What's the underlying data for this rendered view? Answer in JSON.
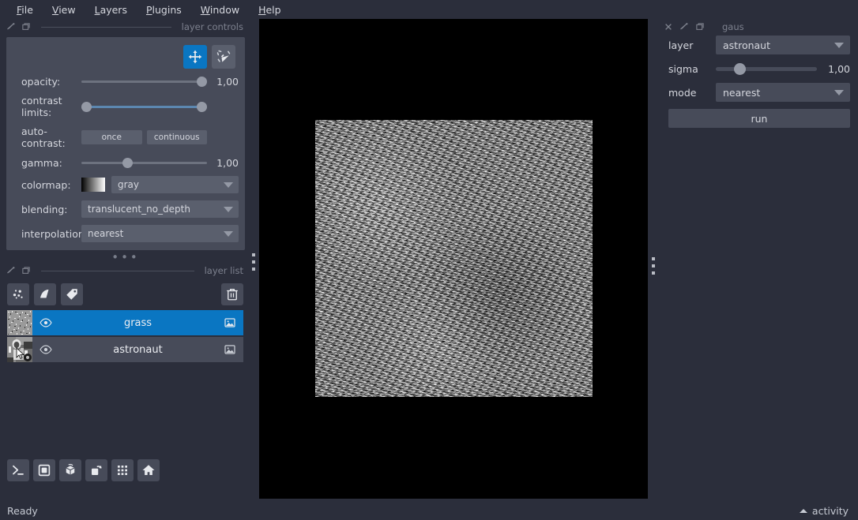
{
  "app": {
    "background": "#2b2e3b",
    "panel_background": "#474b59",
    "accent": "#0a76c2",
    "text": "#d4d6dd",
    "muted_text": "#7d818e"
  },
  "menubar": {
    "items": [
      {
        "label": "File",
        "mnemonic": "F"
      },
      {
        "label": "View",
        "mnemonic": "V"
      },
      {
        "label": "Layers",
        "mnemonic": "L"
      },
      {
        "label": "Plugins",
        "mnemonic": "P"
      },
      {
        "label": "Window",
        "mnemonic": "W"
      },
      {
        "label": "Help",
        "mnemonic": "H"
      }
    ]
  },
  "layer_controls": {
    "dock_title": "layer controls",
    "mode_buttons": [
      {
        "name": "pan-zoom",
        "icon": "move-icon",
        "active": true
      },
      {
        "name": "transform",
        "icon": "transform-icon",
        "active": false
      }
    ],
    "rows": {
      "opacity": {
        "label": "opacity:",
        "value": "1,00",
        "slider_pct": 100
      },
      "contrast_limits": {
        "label": "contrast limits:",
        "low_pct": 0,
        "high_pct": 100
      },
      "auto_contrast": {
        "label": "auto-contrast:",
        "once": "once",
        "continuous": "continuous"
      },
      "gamma": {
        "label": "gamma:",
        "value": "1,00",
        "slider_pct": 33
      },
      "colormap": {
        "label": "colormap:",
        "value": "gray"
      },
      "blending": {
        "label": "blending:",
        "value": "translucent_no_depth"
      },
      "interpolation": {
        "label": "interpolation:",
        "value": "nearest"
      }
    }
  },
  "layer_list": {
    "dock_title": "layer list",
    "toolbar": [
      {
        "name": "new-points-layer",
        "icon": "points-icon"
      },
      {
        "name": "new-shapes-layer",
        "icon": "shapes-icon"
      },
      {
        "name": "new-labels-layer",
        "icon": "labels-icon"
      }
    ],
    "delete_button": {
      "name": "delete-layer",
      "icon": "trash-icon"
    },
    "layers": [
      {
        "name": "grass",
        "selected": true,
        "visible": true,
        "type_icon": "image-icon",
        "thumbnail": "noise"
      },
      {
        "name": "astronaut",
        "selected": false,
        "visible": true,
        "type_icon": "image-icon",
        "thumbnail": "photo"
      }
    ]
  },
  "viewer_buttons": [
    {
      "name": "console-button",
      "icon": "terminal-icon"
    },
    {
      "name": "ndisplay-button",
      "icon": "square-icon"
    },
    {
      "name": "roll-dims-button",
      "icon": "cube-icon"
    },
    {
      "name": "transpose-dims-button",
      "icon": "transpose-icon"
    },
    {
      "name": "grid-view-button",
      "icon": "grid-icon"
    },
    {
      "name": "home-button",
      "icon": "home-icon"
    }
  ],
  "plugin_dock": {
    "title": "gaus",
    "header_icons": [
      "close-icon",
      "float-icon",
      "undock-icon"
    ],
    "rows": {
      "layer": {
        "label": "layer",
        "value": "astronaut"
      },
      "sigma": {
        "label": "sigma",
        "value": "1,00",
        "slider_pct": 18
      },
      "mode": {
        "label": "mode",
        "value": "nearest"
      }
    },
    "run_label": "run"
  },
  "status_bar": {
    "message": "Ready",
    "activity_label": "activity"
  }
}
